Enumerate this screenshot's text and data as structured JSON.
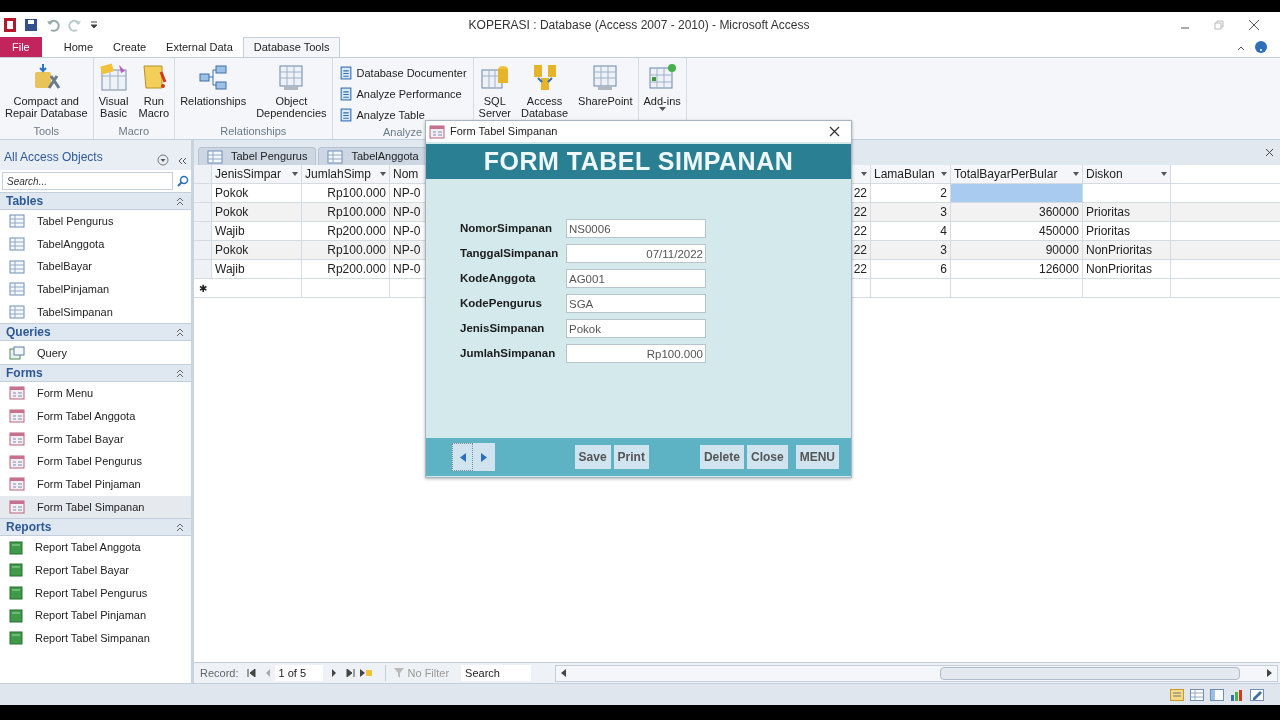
{
  "window": {
    "title": "KOPERASI : Database (Access 2007 - 2010) - Microsoft Access"
  },
  "ribbon_tabs": [
    {
      "label": "File",
      "kind": "file",
      "selected": false
    },
    {
      "label": "Home",
      "kind": "tab",
      "selected": false
    },
    {
      "label": "Create",
      "kind": "tab",
      "selected": false
    },
    {
      "label": "External Data",
      "kind": "tab",
      "selected": false
    },
    {
      "label": "Database Tools",
      "kind": "tab",
      "selected": true
    }
  ],
  "ribbon": {
    "groups": [
      {
        "label": "Tools",
        "buttons": [
          {
            "label": "Compact and\nRepair Database",
            "kind": "large"
          }
        ]
      },
      {
        "label": "Macro",
        "buttons": [
          {
            "label": "Visual\nBasic",
            "kind": "large"
          },
          {
            "label": "Run\nMacro",
            "kind": "large"
          }
        ]
      },
      {
        "label": "Relationships",
        "buttons": [
          {
            "label": "Relationships",
            "kind": "large"
          },
          {
            "label": "Object\nDependencies",
            "kind": "large"
          }
        ]
      },
      {
        "label": "Analyze",
        "buttons": [
          {
            "label": "Database Documenter",
            "kind": "small"
          },
          {
            "label": "Analyze Performance",
            "kind": "small"
          },
          {
            "label": "Analyze Table",
            "kind": "small"
          }
        ]
      },
      {
        "buttons": [
          {
            "label": "SQL\nServer",
            "kind": "large"
          },
          {
            "label": "Access\nDatabase",
            "kind": "large"
          },
          {
            "label": "SharePoint",
            "kind": "large"
          }
        ]
      },
      {
        "buttons": [
          {
            "label": "Add-ins",
            "kind": "dropdown"
          }
        ]
      }
    ]
  },
  "nav_pane": {
    "title": "All Access Objects",
    "search": {
      "placeholder": "Search..."
    },
    "groups": [
      {
        "label": "Tables",
        "kind": "table",
        "items": [
          {
            "label": "Tabel Pengurus",
            "selected": false
          },
          {
            "label": "TabelAnggota",
            "selected": false
          },
          {
            "label": "TabelBayar",
            "selected": false
          },
          {
            "label": "TabelPinjaman",
            "selected": false
          },
          {
            "label": "TabelSimpanan",
            "selected": false
          }
        ]
      },
      {
        "label": "Queries",
        "kind": "query",
        "items": [
          {
            "label": "Query",
            "selected": false
          }
        ]
      },
      {
        "label": "Forms",
        "kind": "form",
        "items": [
          {
            "label": "Form Menu",
            "selected": false
          },
          {
            "label": "Form Tabel Anggota",
            "selected": false
          },
          {
            "label": "Form Tabel Bayar",
            "selected": false
          },
          {
            "label": "Form Tabel Pengurus",
            "selected": false
          },
          {
            "label": "Form Tabel Pinjaman",
            "selected": false
          },
          {
            "label": "Form Tabel Simpanan",
            "selected": true
          }
        ]
      },
      {
        "label": "Reports",
        "kind": "report",
        "items": [
          {
            "label": "Report Tabel Anggota",
            "selected": false
          },
          {
            "label": "Report Tabel Bayar",
            "selected": false
          },
          {
            "label": "Report Tabel Pengurus",
            "selected": false
          },
          {
            "label": "Report Tabel Pinjaman",
            "selected": false
          },
          {
            "label": "Report Tabel Simpanan",
            "selected": false
          }
        ]
      }
    ]
  },
  "document_tabs": [
    {
      "label": "Tabel Pengurus",
      "selected": false
    },
    {
      "label": "TabelAnggota",
      "selected": false
    }
  ],
  "table": {
    "columns": [
      {
        "label": "JenisSimpar"
      },
      {
        "label": "JumlahSimp"
      },
      {
        "label": "Nom"
      },
      {},
      {
        "label": "LamaBulan"
      },
      {
        "label": "TotalBayarPerBular"
      },
      {
        "label": "Diskon"
      }
    ],
    "rows": [
      {
        "cells": [
          {
            "text": "Pokok",
            "selected": false
          },
          {
            "text": "Rp100.000",
            "selected": false
          },
          {
            "text": "NP-0",
            "selected": false
          },
          {
            "text": "22",
            "selected": false
          },
          {
            "text": "2",
            "selected": false
          },
          {
            "selected": true
          },
          {
            "selected": false
          }
        ]
      },
      {
        "cells": [
          {
            "text": "Pokok",
            "selected": false
          },
          {
            "text": "Rp100.000",
            "selected": false
          },
          {
            "text": "NP-0",
            "selected": false
          },
          {
            "text": "22",
            "selected": false
          },
          {
            "text": "3",
            "selected": false
          },
          {
            "text": "360000",
            "selected": false
          },
          {
            "text": "Prioritas",
            "selected": false
          }
        ]
      },
      {
        "cells": [
          {
            "text": "Wajib",
            "selected": false
          },
          {
            "text": "Rp200.000",
            "selected": false
          },
          {
            "text": "NP-0",
            "selected": false
          },
          {
            "text": "22",
            "selected": false
          },
          {
            "text": "4",
            "selected": false
          },
          {
            "text": "450000",
            "selected": false
          },
          {
            "text": "Prioritas",
            "selected": false
          }
        ]
      },
      {
        "cells": [
          {
            "text": "Pokok",
            "selected": false
          },
          {
            "text": "Rp100.000",
            "selected": false
          },
          {
            "text": "NP-0",
            "selected": false
          },
          {
            "text": "22",
            "selected": false
          },
          {
            "text": "3",
            "selected": false
          },
          {
            "text": "90000",
            "selected": false
          },
          {
            "text": "NonPrioritas",
            "selected": false
          }
        ]
      },
      {
        "cells": [
          {
            "text": "Wajib",
            "selected": false
          },
          {
            "text": "Rp200.000",
            "selected": false
          },
          {
            "text": "NP-0",
            "selected": false
          },
          {
            "text": "22",
            "selected": false
          },
          {
            "text": "6",
            "selected": false
          },
          {
            "text": "126000",
            "selected": false
          },
          {
            "text": "NonPrioritas",
            "selected": false
          }
        ]
      }
    ],
    "new_row_marker": "✱"
  },
  "record_nav": {
    "label": "Record:",
    "position": "1 of 5",
    "filter": "No Filter",
    "search": "Search"
  },
  "dialog": {
    "title": "Form Tabel Simpanan",
    "heading": "FORM TABEL SIMPANAN",
    "fields": [
      {
        "label": "NomorSimpanan",
        "value": "NS0006",
        "kind": "text"
      },
      {
        "label": "TanggalSimpanan",
        "value": "07/11/2022",
        "kind": "date"
      },
      {
        "label": "KodeAnggota",
        "value": "AG001",
        "kind": "text"
      },
      {
        "label": "KodePengurus",
        "value": "SGA",
        "kind": "text"
      },
      {
        "label": "JenisSimpanan",
        "value": "Pokok",
        "kind": "text"
      },
      {
        "label": "JumlahSimpanan",
        "value": "Rp100.000",
        "kind": "currency"
      }
    ],
    "buttons": [
      {
        "label": "Save"
      },
      {
        "label": "Print"
      },
      {
        "label": "Delete"
      },
      {
        "label": "Close"
      },
      {
        "label": "MENU"
      }
    ]
  }
}
